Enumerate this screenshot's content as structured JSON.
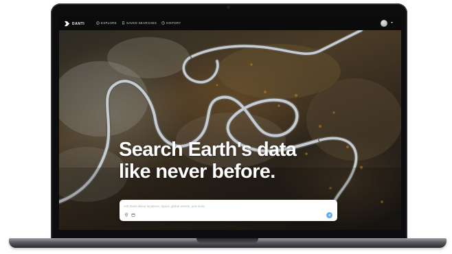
{
  "app": {
    "logo_text": "DANTI",
    "nav": [
      {
        "label": "EXPLORE",
        "icon": "compass-icon"
      },
      {
        "label": "SAVED SEARCHES",
        "icon": "bookmark-icon"
      },
      {
        "label": "HISTORY",
        "icon": "clock-icon"
      }
    ],
    "account": {
      "avatar": "avatar-icon",
      "menu": "chevron-down-icon"
    }
  },
  "hero": {
    "headline_line1": "Search Earth's data",
    "headline_line2": "like never before.",
    "background": "aerial mountain road photo"
  },
  "search": {
    "placeholder": "Ask Danti about locations, topics, global events, and more",
    "value": "",
    "icons": [
      "location-pin-icon",
      "calendar-icon"
    ],
    "submit_icon": "send-icon"
  },
  "colors": {
    "nav_bg": "#0b0b0c",
    "accent": "#61aef5",
    "headline": "#ffffff"
  }
}
